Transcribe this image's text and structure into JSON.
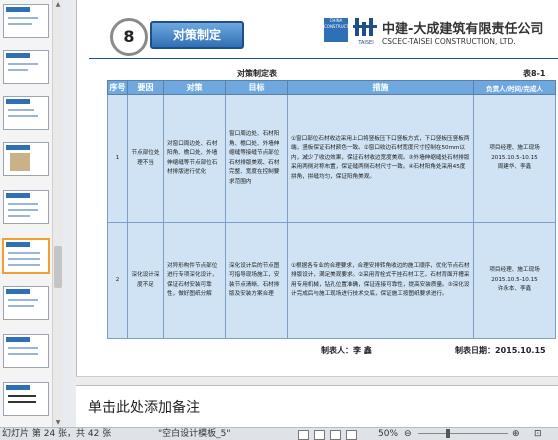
{
  "slide": {
    "number_badge": "8",
    "title": "对策制定",
    "logo": {
      "box_text": "CHINA CONSTRUCTION",
      "taisei_text": "TAISEI"
    },
    "company_cn": "中建-大成建筑有限责任公司",
    "company_en": "CSCEC-TAISEI CONSTRUCTION, LTD.",
    "table_title": "对策制定表",
    "table_no": "表8-1",
    "headers": [
      "序号",
      "要因",
      "对策",
      "目标",
      "措施",
      "负责人/时间/完成人"
    ],
    "rows": [
      {
        "no": "1",
        "cause": "节点部位处理不当",
        "countermeasure": "对窗口周边处、石材阳角、檐口处、外墙伸缩缝等节点部位石材排版进行优化",
        "goal": "窗口周边处、石材阳角、檐口处、外墙伸缩缝等接缝节点部位石材排版美观、石材完整、宽度在控制要求范围内",
        "measures": "①窗口部位石材收边采用上口将竖板压下口竖板方式，下口竖板压竖板两端，竖板保证石材颜色一致。②窗口收边石材宽度尺寸控制在50mm以内，减少了收边效果，保证石材收边宽度美观。③外墙伸缩缝处石材排版采用两侧对称布置，保证缝两侧石材尺寸一致。④石材阳角处采用45度拼角，拼缝均匀，保证阳角美观。",
        "owner": "项目经理、施工现场\n2015.10.5-10.15\n周建华、李鑫"
      },
      {
        "no": "2",
        "cause": "深化设计深度不足",
        "countermeasure": "对异形构件节点部位进行专项深化设计，保证石材安装可靠性，做好图纸分解",
        "goal": "深化设计后的节点图可指导现场施工，安装节点清晰、石材排版及安装方案合理",
        "measures": "①根据各专业的合理要求，合理安排转角收边的施工顺序，优化节点石材排版设计，满足美观要求。②采用背栓式干挂石材工艺，石材背面开槽采用专用机械，钻孔位置准确，保证连接可靠性，提高安装质量。③深化设计完成后与施工现场进行技术交底，保证施工按图纸要求进行。",
        "owner": "项目经理、施工现场\n2015.10.5-10.15\n许永本、李鑫"
      }
    ],
    "prepared_by": "制表人：李  鑫",
    "prepared_date": "制表日期：2015.10.15"
  },
  "notes_placeholder": "单击此处添加备注",
  "status": {
    "slide_info": "幻灯片 第 24 张，共 42 张",
    "theme": "\"空白设计模板_5\"",
    "zoom": "50%"
  }
}
